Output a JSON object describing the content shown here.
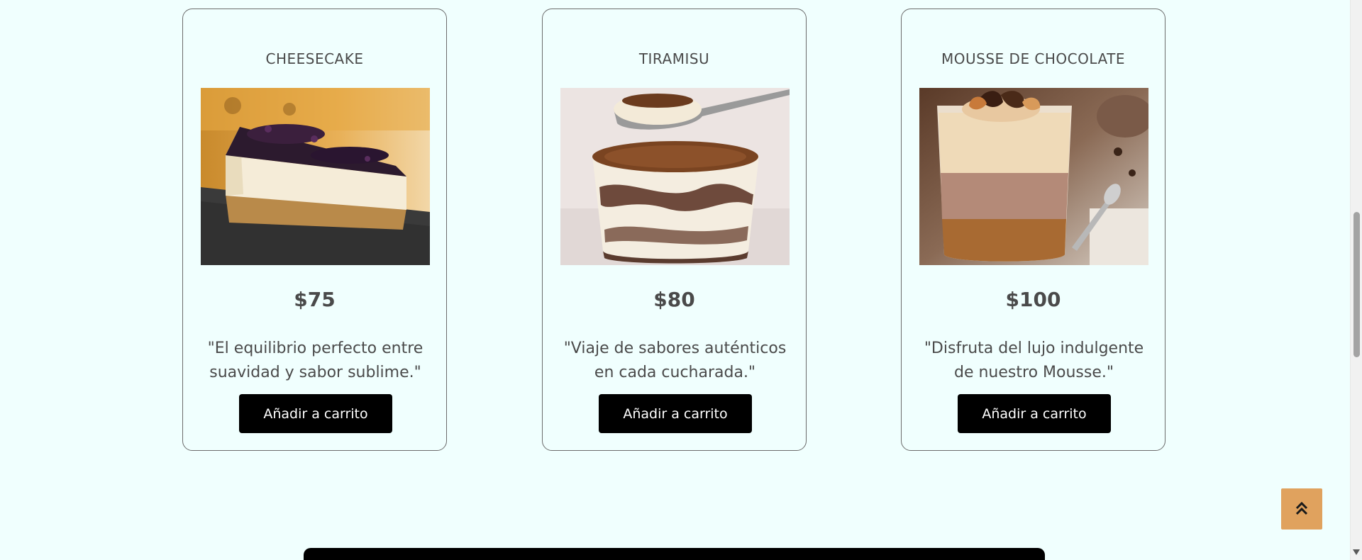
{
  "products": [
    {
      "title": "CHEESECAKE",
      "price": "$75",
      "description": "\"El equilibrio perfecto entre suavidad y sabor sublime.\"",
      "button_label": "Añadir a carrito",
      "image_icon": "cheesecake-image"
    },
    {
      "title": "TIRAMISU",
      "price": "$80",
      "description": "\"Viaje de sabores auténticos en cada cucharada.\"",
      "button_label": "Añadir a carrito",
      "image_icon": "tiramisu-image"
    },
    {
      "title": "MOUSSE DE CHOCOLATE",
      "price": "$100",
      "description": "\"Disfruta del lujo indulgente de nuestro Mousse.\"",
      "button_label": "Añadir a carrito",
      "image_icon": "chocolate-mousse-image"
    }
  ],
  "scroll_top_button": {
    "icon": "double-chevron-up-icon",
    "color": "#e0a25e"
  },
  "colors": {
    "background": "#f0fffe",
    "button": "#000000",
    "text": "#4a4a4a"
  }
}
